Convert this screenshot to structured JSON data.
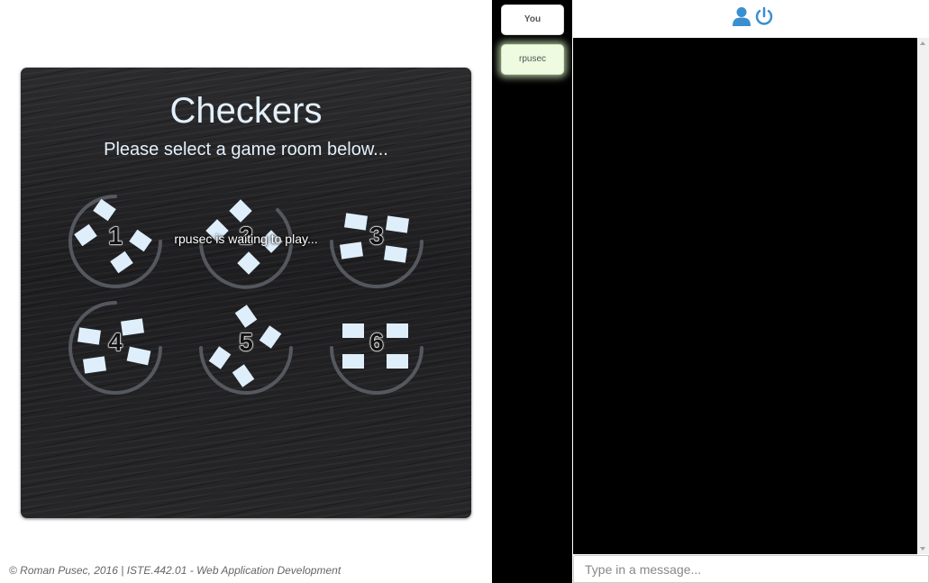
{
  "game": {
    "title": "Checkers",
    "subtitle": "Please select a game room below...",
    "rooms": [
      {
        "number": "1",
        "status": ""
      },
      {
        "number": "2",
        "status": "rpusec is waiting to play..."
      },
      {
        "number": "3",
        "status": ""
      },
      {
        "number": "4",
        "status": ""
      },
      {
        "number": "5",
        "status": ""
      },
      {
        "number": "6",
        "status": ""
      }
    ]
  },
  "footer": {
    "text": "© Roman Pusec, 2016 | ISTE.442.01 - Web Application Development"
  },
  "users": {
    "you_label": "You",
    "others": [
      "rpusec"
    ]
  },
  "chat": {
    "icons": [
      "user-icon",
      "power-icon"
    ],
    "input_placeholder": "Type in a message...",
    "input_value": ""
  },
  "colors": {
    "panel_background": "#212123",
    "title_text": "#e3f0fb",
    "room_tile": "#dfeefb",
    "room_arc": "#5e6168",
    "icon_blue": "#3a8fd0",
    "chat_background": "#000000",
    "online_user_highlight": "#eefbe0"
  }
}
